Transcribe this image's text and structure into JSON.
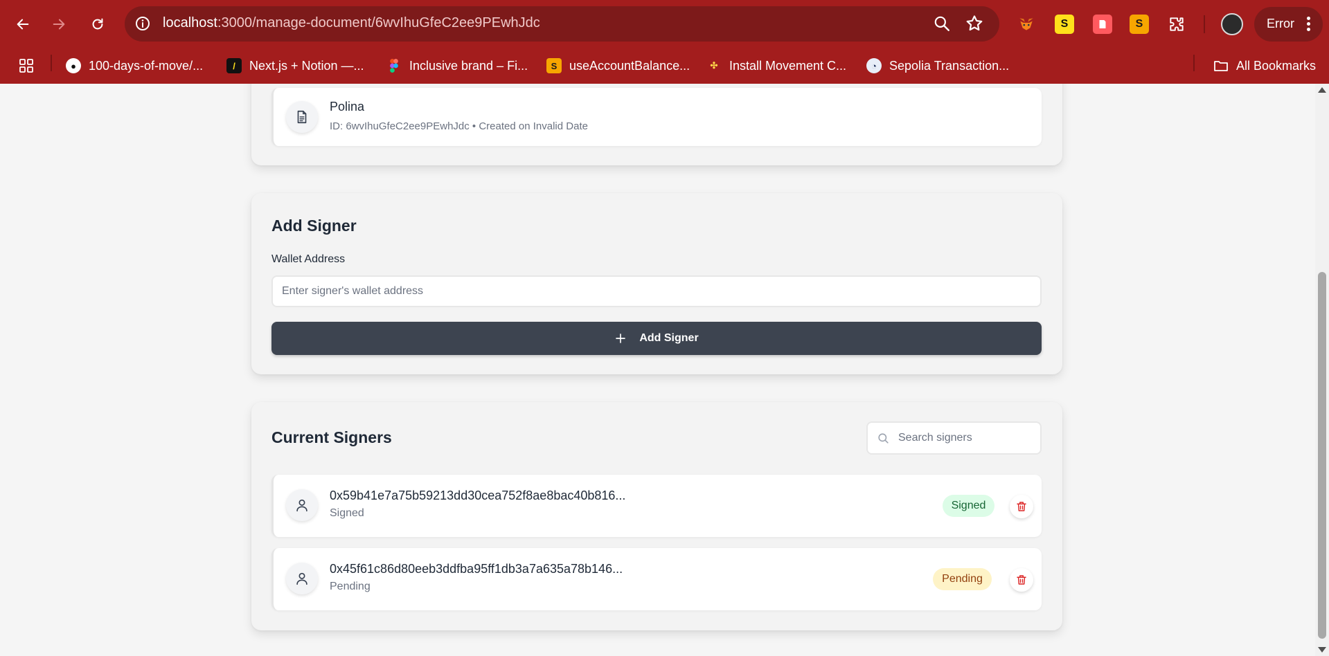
{
  "browser": {
    "url_host": "localhost",
    "url_rest": ":3000/manage-document/6wvIhuGfeC2ee9PEwhJdc",
    "profile_button_label": "Error",
    "bookmarks": [
      {
        "label": "100-days-of-move/...",
        "icon": "github-icon"
      },
      {
        "label": "Next.js + Notion —...",
        "icon": "nextjs-notion-icon"
      },
      {
        "label": "Inclusive brand – Fi...",
        "icon": "figma-icon"
      },
      {
        "label": "useAccountBalance...",
        "icon": "wagmi-icon"
      },
      {
        "label": "Install Movement C...",
        "icon": "movement-icon"
      },
      {
        "label": "Sepolia Transaction...",
        "icon": "etherscan-icon"
      }
    ],
    "all_bookmarks_label": "All Bookmarks"
  },
  "document": {
    "name": "Polina",
    "meta": "ID: 6wvIhuGfeC2ee9PEwhJdc • Created on Invalid Date"
  },
  "add_signer": {
    "title": "Add Signer",
    "field_label": "Wallet Address",
    "placeholder": "Enter signer's wallet address",
    "button_label": "Add Signer"
  },
  "current_signers": {
    "title": "Current Signers",
    "search_placeholder": "Search signers",
    "signers": [
      {
        "address": "0x59b41e7a75b59213dd30cea752f8ae8bac40b816...",
        "status": "Signed",
        "badge": "Signed"
      },
      {
        "address": "0x45f61c86d80eeb3ddfba95ff1db3a7a635a78b146...",
        "status": "Pending",
        "badge": "Pending"
      }
    ]
  },
  "colors": {
    "browser_frame": "#a31d1d",
    "primary_button": "#3d4450",
    "signed_badge_bg": "#dcfce7",
    "signed_badge_text": "#166534",
    "pending_badge_bg": "#fef3c7",
    "pending_badge_text": "#92400e",
    "delete_icon": "#dc2626"
  }
}
